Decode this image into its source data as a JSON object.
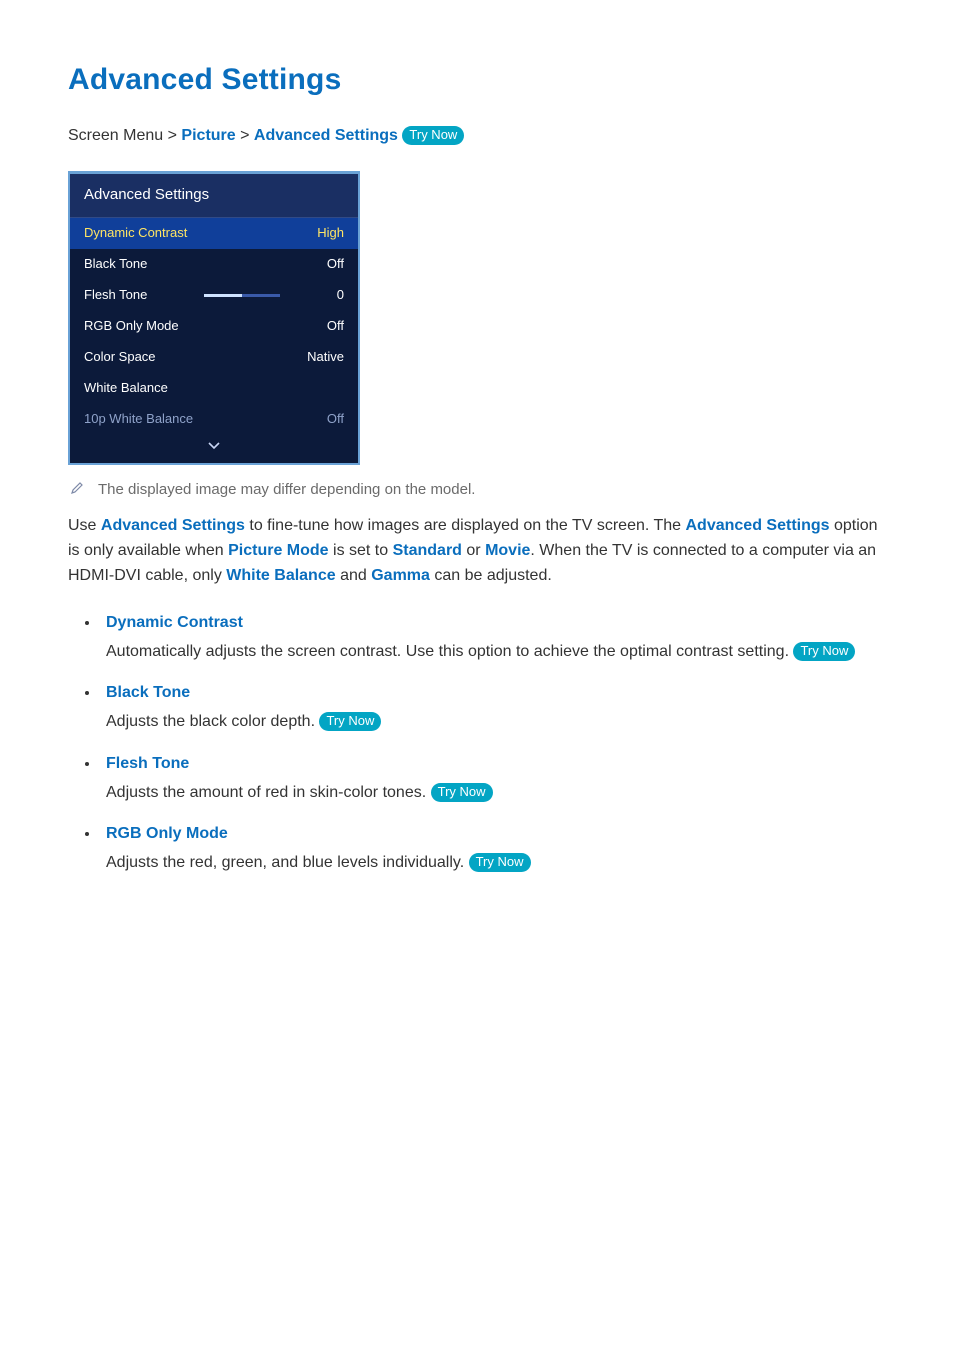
{
  "page_title": "Advanced Settings",
  "breadcrumb": {
    "prefix": "Screen Menu",
    "sep": ">",
    "picture": "Picture",
    "advanced": "Advanced Settings",
    "try_now": "Try Now"
  },
  "panel": {
    "title": "Advanced Settings",
    "rows": [
      {
        "label": "Dynamic Contrast",
        "value": "High",
        "kind": "sel"
      },
      {
        "label": "Black Tone",
        "value": "Off",
        "kind": "norm"
      },
      {
        "label": "Flesh Tone",
        "value": "0",
        "kind": "slider"
      },
      {
        "label": "RGB Only Mode",
        "value": "Off",
        "kind": "norm"
      },
      {
        "label": "Color Space",
        "value": "Native",
        "kind": "norm"
      },
      {
        "label": "White Balance",
        "value": "",
        "kind": "norm"
      },
      {
        "label": "10p White Balance",
        "value": "Off",
        "kind": "dim"
      }
    ]
  },
  "note": "The displayed image may differ depending on the model.",
  "intro": {
    "t1": "Use ",
    "adv": "Advanced Settings",
    "t2": " to fine-tune how images are displayed on the TV screen. The ",
    "adv2": "Advanced Settings",
    "t3": " option is only available when ",
    "pm": "Picture Mode",
    "t4": " is set to ",
    "std": "Standard",
    "or": " or ",
    "mov": "Movie",
    "t5": ". When the TV is connected to a computer via an HDMI-DVI cable, only ",
    "wb": "White Balance",
    "and": " and ",
    "gm": "Gamma",
    "t6": " can be adjusted."
  },
  "bullets": [
    {
      "title": "Dynamic Contrast",
      "body": "Automatically adjusts the screen contrast. Use this option to achieve the optimal contrast setting.",
      "try": "Try Now"
    },
    {
      "title": "Black Tone",
      "body": "Adjusts the black color depth.",
      "try": "Try Now"
    },
    {
      "title": "Flesh Tone",
      "body": "Adjusts the amount of red in skin-color tones.",
      "try": "Try Now"
    },
    {
      "title": "RGB Only Mode",
      "body": "Adjusts the red, green, and blue levels individually.",
      "try": "Try Now"
    }
  ]
}
